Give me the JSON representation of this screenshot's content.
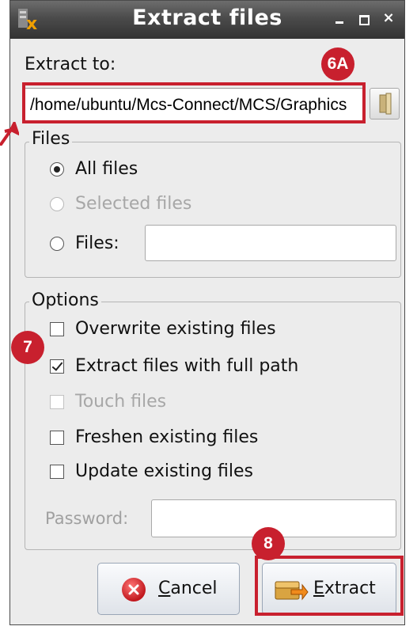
{
  "window": {
    "title": "Extract files",
    "minimize_glyph": "–",
    "maximize_glyph": "□",
    "close_glyph": "×"
  },
  "extract_to": {
    "label": "Extract to:",
    "path": "/home/ubuntu/Mcs-Connect/MCS/Graphics"
  },
  "files_group": {
    "title": "Files",
    "options": [
      {
        "label": "All files",
        "selected": true,
        "enabled": true
      },
      {
        "label": "Selected files",
        "selected": false,
        "enabled": false
      },
      {
        "label": "Files:",
        "selected": false,
        "enabled": true
      }
    ],
    "files_value": ""
  },
  "options_group": {
    "title": "Options",
    "checks": [
      {
        "label": "Overwrite existing files",
        "checked": false,
        "enabled": true
      },
      {
        "label": "Extract files with full path",
        "checked": true,
        "enabled": true
      },
      {
        "label": "Touch files",
        "checked": false,
        "enabled": false
      },
      {
        "label": "Freshen existing files",
        "checked": false,
        "enabled": true
      },
      {
        "label": "Update existing files",
        "checked": false,
        "enabled": true
      }
    ],
    "password_label": "Password:",
    "password_value": ""
  },
  "buttons": {
    "cancel_mnemonic": "C",
    "cancel_rest": "ancel",
    "extract_mnemonic": "E",
    "extract_rest": "xtract"
  },
  "annotations": {
    "path_badge": "6A",
    "options_badge": "7",
    "extract_badge": "8",
    "highlight_color": "#c8202e"
  }
}
